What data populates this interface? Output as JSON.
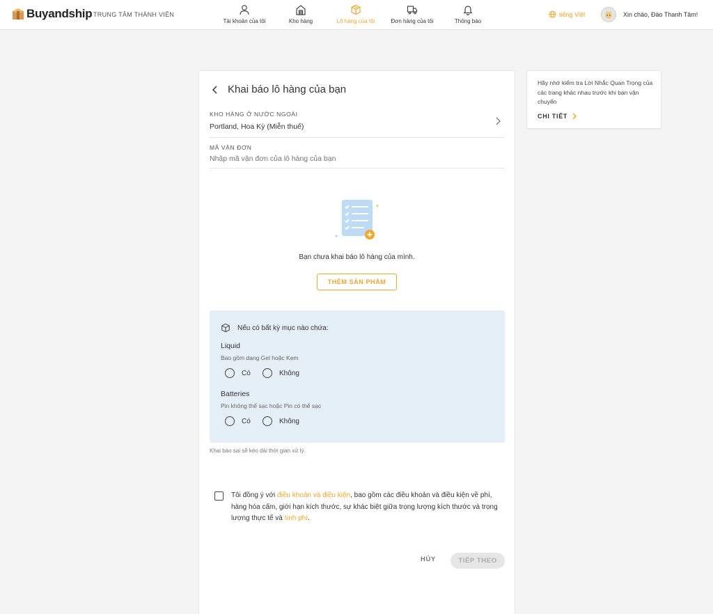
{
  "header": {
    "brand": "Buyandship",
    "member_center": "TRUNG TÂM THÀNH VIÊN",
    "nav": [
      {
        "label": "Tài khoản của tôi",
        "icon": "user-icon"
      },
      {
        "label": "Kho hàng",
        "icon": "warehouse-icon"
      },
      {
        "label": "Lô hàng của tôi",
        "icon": "box-icon",
        "active": true
      },
      {
        "label": "Đơn hàng của tôi",
        "icon": "truck-icon"
      },
      {
        "label": "Thông báo",
        "icon": "bell-icon"
      }
    ],
    "language": "tiếng Việt",
    "greeting": "Xin chào, Đào Thanh Tâm!"
  },
  "form": {
    "title": "Khai báo lô hàng của bạn",
    "warehouse_label": "KHO HÀNG Ở NƯỚC NGOÀI",
    "warehouse_value": "Portland, Hoa Kỳ (Miễn thuế)",
    "tracking_label": "MÃ VẬN ĐƠN",
    "tracking_placeholder": "Nhập mã vận đơn của lô hàng của bạn",
    "empty_text": "Bạn chưa khai báo lô hàng của mình.",
    "add_product": "THÊM SẢN PHẨM",
    "notice": {
      "title": "Nếu có bất kỳ mục nào chứa:",
      "questions": [
        {
          "title": "Liquid",
          "subtitle": "Bao gồm dạng Gel hoặc Kem",
          "yes": "Có",
          "no": "Không"
        },
        {
          "title": "Batteries",
          "subtitle": "Pin không thể sạc hoặc Pin có thể sạc",
          "yes": "Có",
          "no": "Không"
        }
      ]
    },
    "hint": "Khai báo sai sẽ kéo dài thời gian xử lý.",
    "agree": {
      "prefix": "Tôi đồng ý với ",
      "terms_link": "điều khoản và điều kiện",
      "middle": ", bao gồm các điều khoản và điều kiện về phí, hàng hóa cấm, giới hạn kích thước, sự khác biệt giữa trọng lượng kích thước và trọng lượng thực tế và ",
      "fee_link": "tính phí",
      "suffix": "."
    },
    "cancel": "HỦY",
    "next": "TIẾP THEO"
  },
  "side": {
    "text": "Hãy nhớ kiểm tra Lời Nhắc Quan Trọng của các trang khác nhau trước khi bạn vận chuyển",
    "link": "CHI TIẾT"
  },
  "colors": {
    "accent": "#f5a623",
    "notice_bg": "#e5eff8"
  }
}
